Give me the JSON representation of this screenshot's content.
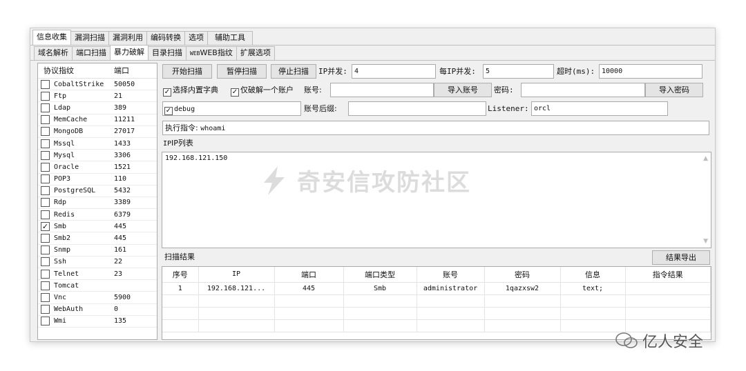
{
  "top_tabs": [
    "信息收集",
    "漏洞扫描",
    "漏洞利用",
    "编码转换",
    "选项",
    "辅助工具"
  ],
  "sub_tabs": [
    "域名解析",
    "端口扫描",
    "暴力破解",
    "目录扫描",
    "WEB指纹",
    "扩展选项"
  ],
  "protocol_table": {
    "headers": {
      "protocol": "协议指纹",
      "port": "端口"
    },
    "rows": [
      {
        "name": "CobaltStrike",
        "port": "50050",
        "checked": false
      },
      {
        "name": "Ftp",
        "port": "21",
        "checked": false
      },
      {
        "name": "Ldap",
        "port": "389",
        "checked": false
      },
      {
        "name": "MemCache",
        "port": "11211",
        "checked": false
      },
      {
        "name": "MongoDB",
        "port": "27017",
        "checked": false
      },
      {
        "name": "Mssql",
        "port": "1433",
        "checked": false
      },
      {
        "name": "Mysql",
        "port": "3306",
        "checked": false
      },
      {
        "name": "Oracle",
        "port": "1521",
        "checked": false
      },
      {
        "name": "POP3",
        "port": "110",
        "checked": false
      },
      {
        "name": "PostgreSQL",
        "port": "5432",
        "checked": false
      },
      {
        "name": "Rdp",
        "port": "3389",
        "checked": false
      },
      {
        "name": "Redis",
        "port": "6379",
        "checked": false
      },
      {
        "name": "Smb",
        "port": "445",
        "checked": true
      },
      {
        "name": "Smb2",
        "port": "445",
        "checked": false
      },
      {
        "name": "Snmp",
        "port": "161",
        "checked": false
      },
      {
        "name": "Ssh",
        "port": "22",
        "checked": false
      },
      {
        "name": "Telnet",
        "port": "23",
        "checked": false
      },
      {
        "name": "Tomcat",
        "port": "",
        "checked": false
      },
      {
        "name": "Vnc",
        "port": "5900",
        "checked": false
      },
      {
        "name": "WebAuth",
        "port": "0",
        "checked": false
      },
      {
        "name": "Wmi",
        "port": "135",
        "checked": false
      }
    ]
  },
  "controls": {
    "start_scan": "开始扫描",
    "pause_scan": "暂停扫描",
    "stop_scan": "停止扫描",
    "ip_concurrency_label": "IP并发:",
    "ip_concurrency_value": "4",
    "per_ip_concurrency_label": "每IP并发:",
    "per_ip_concurrency_value": "5",
    "timeout_label": "超时(ms):",
    "timeout_value": "10000",
    "builtin_dict_label": "选择内置字典",
    "builtin_dict_checked": true,
    "crack_one_label": "仅破解一个账户",
    "crack_one_checked": true,
    "account_label": "账号:",
    "account_value": "",
    "import_account": "导入账号",
    "password_label": "密码:",
    "password_value": "",
    "import_password": "导入密码",
    "debug_label": "debug",
    "debug_checked": true,
    "account_suffix_label": "账号后缀:",
    "account_suffix_value": "",
    "listener_label": "Listener:",
    "listener_value": "orcl",
    "exec_label": "执行指令:",
    "exec_value": "whoami"
  },
  "ip_list": {
    "title": "IP列表",
    "content": "192.168.121.150"
  },
  "scan_results": {
    "title": "扫描结果",
    "export": "结果导出",
    "columns": [
      "序号",
      "IP",
      "端口",
      "端口类型",
      "账号",
      "密码",
      "信息",
      "指令结果"
    ],
    "rows": [
      [
        "1",
        "192.168.121...",
        "445",
        "Smb",
        "administrator",
        "1qazxsw2",
        "text;",
        ""
      ]
    ]
  },
  "watermark": "奇安信攻防社区",
  "brand": "亿人安全"
}
